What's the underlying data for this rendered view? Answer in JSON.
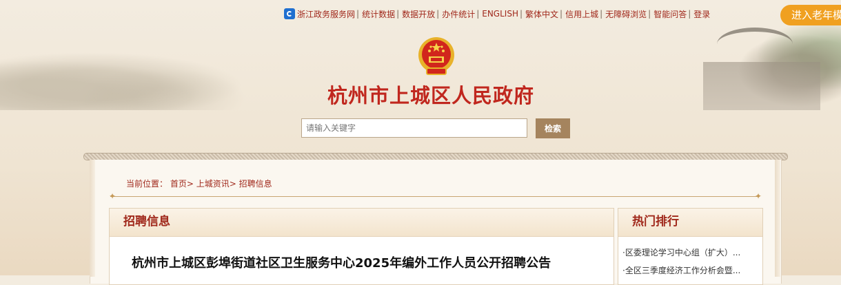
{
  "topnav": {
    "items": [
      "浙江政务服务网",
      "统计数据",
      "数据开放",
      "办件统计",
      "ENGLISH",
      "繁体中文",
      "信用上城",
      "无障碍浏览",
      "智能问答",
      "登录"
    ],
    "elder_mode": "进入老年模式"
  },
  "header": {
    "title": "杭州市上城区人民政府"
  },
  "search": {
    "placeholder": "请输入关键字",
    "button": "检索"
  },
  "breadcrumb": {
    "label": "当前位置：",
    "items": [
      "首页",
      "上城资讯",
      "招聘信息"
    ]
  },
  "main": {
    "section_title": "招聘信息",
    "article_title": "杭州市上城区彭埠街道社区卫生服务中心2025年编外工作人员公开招聘公告"
  },
  "sidebar": {
    "title": "热门排行",
    "items": [
      "·区委理论学习中心组（扩大）...",
      "·全区三季度经济工作分析会暨..."
    ]
  },
  "colors": {
    "accent_red": "#a0281b",
    "elder_button": "#f0a020",
    "search_button": "#a5845e"
  }
}
